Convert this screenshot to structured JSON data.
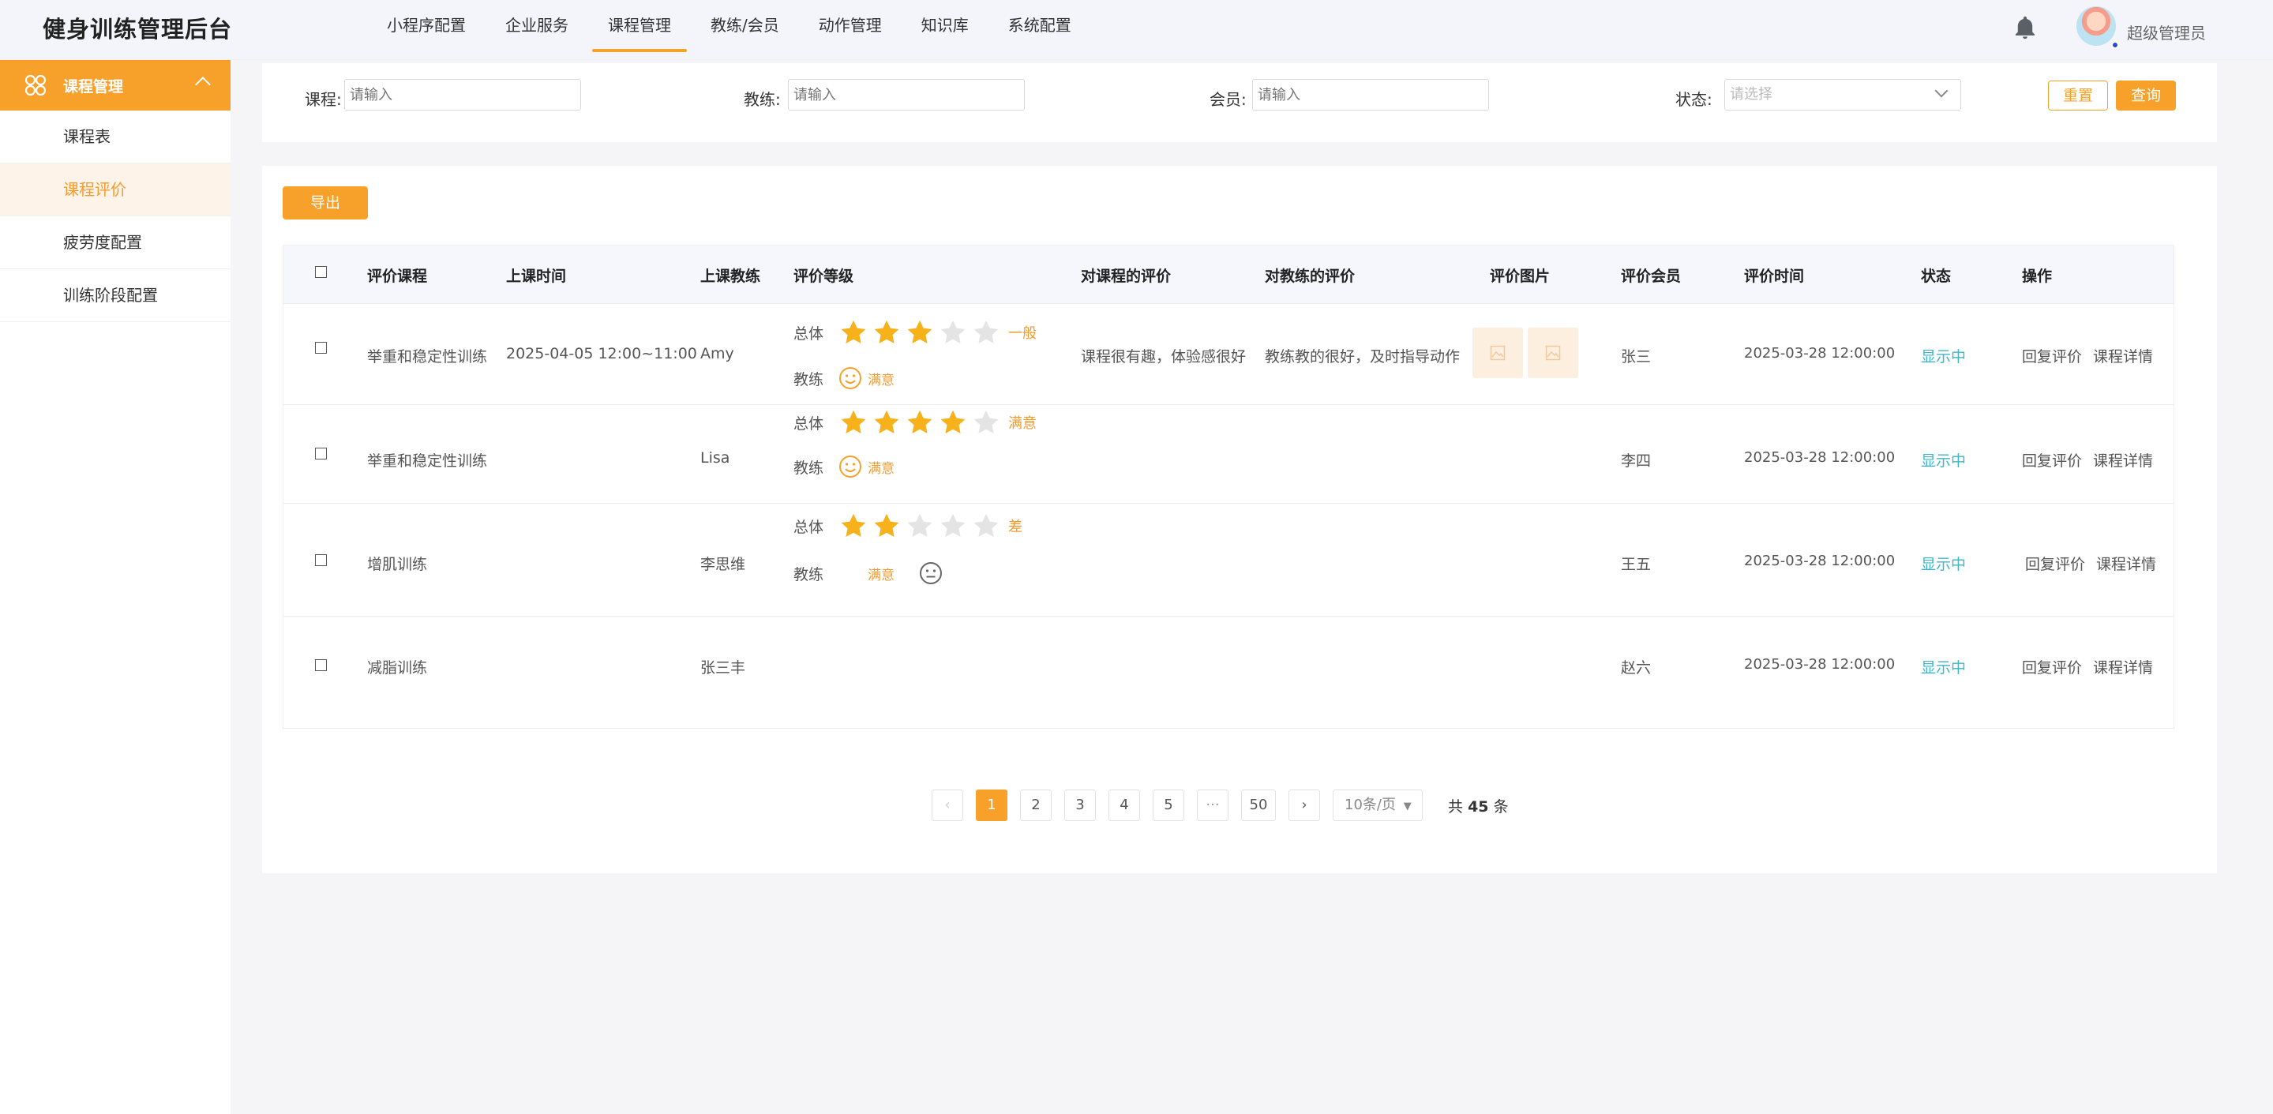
{
  "app": {
    "brand": "健身训练管理后台",
    "username": "超级管理员"
  },
  "nav": [
    {
      "label": "小程序配置"
    },
    {
      "label": "企业服务"
    },
    {
      "label": "课程管理",
      "active": true
    },
    {
      "label": "教练/会员"
    },
    {
      "label": "动作管理"
    },
    {
      "label": "知识库"
    },
    {
      "label": "系统配置"
    }
  ],
  "sidebar": {
    "group": "课程管理",
    "items": [
      {
        "label": "课程表"
      },
      {
        "label": "课程评价",
        "active": true
      },
      {
        "label": "疲劳度配置"
      },
      {
        "label": "训练阶段配置"
      }
    ]
  },
  "filters": {
    "course_label": "课程:",
    "course_placeholder": "请输入",
    "coach_label": "教练:",
    "coach_placeholder": "请输入",
    "member_label": "会员:",
    "member_placeholder": "请输入",
    "status_label": "状态:",
    "status_placeholder": "请选择",
    "reset": "重置",
    "query": "查询"
  },
  "toolbar": {
    "export": "导出"
  },
  "table": {
    "headers": [
      "评价课程",
      "上课时间",
      "上课教练",
      "评价等级",
      "对课程的评价",
      "对教练的评价",
      "评价图片",
      "评价会员",
      "评价时间",
      "状态",
      "操作"
    ],
    "overall_label": "总体",
    "coach_label": "教练",
    "rows": [
      {
        "course": "举重和稳定性训练",
        "time": "2025-04-05 12:00~11:00",
        "coach": "Amy",
        "stars": 3,
        "overall_text": "一般",
        "coach_rating": "满意",
        "course_review": "课程很有趣，体验感很好",
        "coach_review": "教练教的很好，及时指导动作",
        "images": 2,
        "member": "张三",
        "review_time": "2025-03-28 12:00:00",
        "status": "显示中",
        "op_reply": "回复评价",
        "op_detail": "课程详情"
      },
      {
        "course": "举重和稳定性训练",
        "time": "",
        "coach": "Lisa",
        "stars": 4,
        "overall_text": "满意",
        "coach_rating": "满意",
        "course_review": "",
        "coach_review": "",
        "images": 0,
        "member": "李四",
        "review_time": "2025-03-28 12:00:00",
        "status": "显示中",
        "op_reply": "回复评价",
        "op_detail": "课程详情"
      },
      {
        "course": "增肌训练",
        "time": "",
        "coach": "李思维",
        "stars": 2,
        "overall_text": "差",
        "coach_rating": "满意",
        "course_review": "",
        "coach_review": "",
        "images": 0,
        "member": "王五",
        "review_time": "2025-03-28 12:00:00",
        "status": "显示中",
        "op_reply": "回复评价",
        "op_detail": "课程详情"
      },
      {
        "course": "减脂训练",
        "time": "",
        "coach": "张三丰",
        "member": "赵六",
        "review_time": "2025-03-28 12:00:00",
        "status": "显示中",
        "op_reply": "回复评价",
        "op_detail": "课程详情"
      }
    ]
  },
  "pagination": {
    "prev": "‹",
    "pages": [
      "1",
      "2",
      "3",
      "4",
      "5",
      "···",
      "50"
    ],
    "next": "›",
    "page_size": "10条/页",
    "total_prefix": "共",
    "total": "45",
    "total_suffix": "条"
  },
  "colors": {
    "accent": "#f7a12b",
    "status": "#3fb5c9",
    "star_on": "#f7b21b",
    "star_off": "#e4e4e4"
  }
}
